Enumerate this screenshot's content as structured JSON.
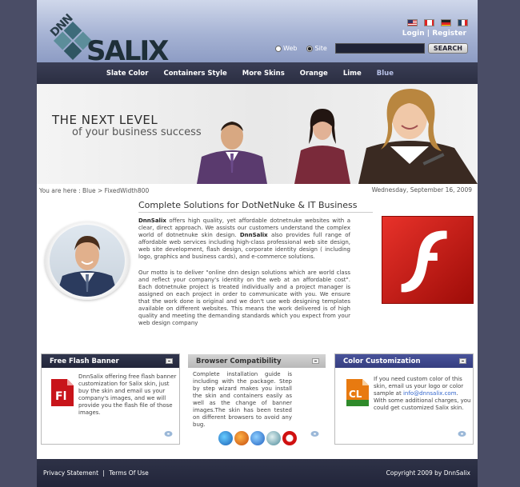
{
  "header": {
    "logo": {
      "prefix": "DNN",
      "name": "SALIX"
    },
    "flags": [
      "US",
      "CA",
      "DE",
      "FR"
    ],
    "auth": {
      "login": "Login",
      "separator": "|",
      "register": "Register"
    },
    "search": {
      "option_web": "Web",
      "option_site": "Site",
      "selected": "Site",
      "button": "SEARCH",
      "value": ""
    }
  },
  "nav": {
    "items": [
      "Slate Color",
      "Containers Style",
      "More Skins",
      "Orange",
      "Lime",
      "Blue"
    ],
    "active": "Blue"
  },
  "banner": {
    "line1": "THE NEXT LEVEL",
    "line2": "of your business success"
  },
  "breadcrumb": {
    "prefix": "You are here :",
    "path": "Blue > FixedWidth800"
  },
  "date": "Wednesday, September 16, 2009",
  "main": {
    "title": "Complete Solutions for DotNetNuke & IT Business",
    "para1_brand": "DnnSalix",
    "para1_a": " offers high quality, yet affordable dotnetnuke websites with a clear, direct approach. We assists our customers understand the complex world of dotnetnuke skin design. ",
    "para1_brand2": "DnnSalix",
    "para1_b": " also provides full range of affordable web services including high-class professional web site design, web site development, flash design, corporate identity design ( including logo, graphics and business cards), and e-commerce solutions.",
    "para2": "Our motto is to deliver \"online dnn design solutions which are world class and reflect your company's identity on the web at an affordable cost\". Each dotnetnuke project is treated individually and a project manager is assigned on each project in order to communicate with you. We ensure that the work done is original and we don't use web designing templates available on different websites. This means the work delivered is of high quality and meeting the demanding standards which you expect from your web design company"
  },
  "boxes": [
    {
      "title": "Free Flash Banner",
      "text": "DnnSalix offering free flash banner customization for Salix skin, just buy the skin and email us your company's images, and we will provide you the flash file of those images.",
      "icon": "flash-file-icon"
    },
    {
      "title": "Browser Compatibility",
      "text": "Complete installation guide is including with the package. Step by step wizard makes you  install the skin and containers easily as well as the change of banner images.The skin has been tested on different browsers to avoid any bug.",
      "browsers": [
        "Internet Explorer",
        "Firefox",
        "Internet Explorer 8",
        "Safari",
        "Opera"
      ]
    },
    {
      "title": "Color Customization",
      "text_a": "If you need custom color of this skin, email us your logo or color sample at ",
      "email": "info@dnnsalix.com",
      "text_b": ".\nWith some additional charges, you could get customized Salix skin.",
      "icon": "color-layout-icon"
    }
  ],
  "footer": {
    "privacy": "Privacy Statement",
    "separator": "|",
    "terms": "Terms Of Use",
    "copyright": "Copyright 2009 by DnnSalix"
  },
  "colors": {
    "page_bg": "#4a4d66",
    "nav_bg": "#2b2e42",
    "accent_blue": "#353e80",
    "flash_red": "#d21f18"
  }
}
